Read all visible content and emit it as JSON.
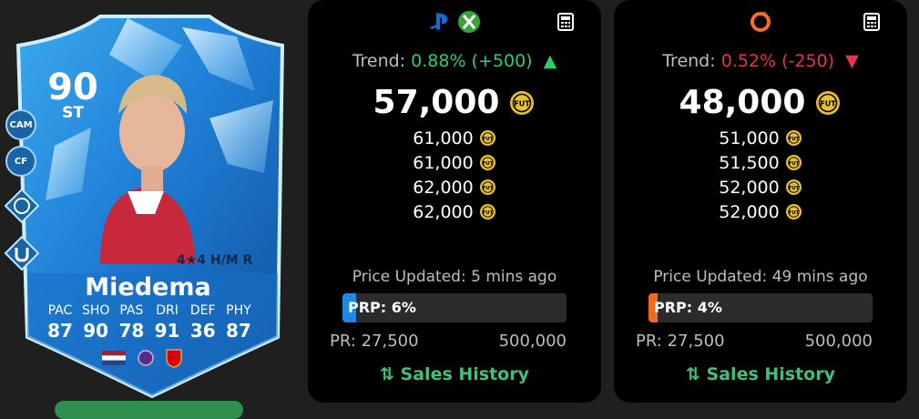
{
  "card": {
    "rating": "90",
    "position": "ST",
    "alt_positions": [
      "CAM",
      "CF"
    ],
    "skills": "4★4 H/M R",
    "name": "Miedema",
    "stats": [
      {
        "label": "PAC",
        "value": "87"
      },
      {
        "label": "SHO",
        "value": "90"
      },
      {
        "label": "PAS",
        "value": "78"
      },
      {
        "label": "DRI",
        "value": "91"
      },
      {
        "label": "DEF",
        "value": "36"
      },
      {
        "label": "PHY",
        "value": "87"
      }
    ],
    "icons": [
      "flag-netherlands-icon",
      "league-badge-icon",
      "club-badge-icon"
    ]
  },
  "panels": [
    {
      "platform_icons": [
        "playstation-icon",
        "xbox-icon"
      ],
      "trend_label": "Trend:",
      "trend_value": "0.88% (+500)",
      "trend_direction": "up",
      "price": "57,000",
      "listings": [
        "61,000",
        "61,000",
        "62,000",
        "62,000"
      ],
      "updated": "Price Updated: 5 mins ago",
      "prp_label": "PRP: 6%",
      "prp_fraction": 0.06,
      "prp_color": "#1e88e5",
      "pr_min": "PR: 27,500",
      "pr_max": "500,000",
      "sales_label": "Sales History"
    },
    {
      "platform_icons": [
        "origin-icon"
      ],
      "trend_label": "Trend:",
      "trend_value": "0.52% (-250)",
      "trend_direction": "down",
      "price": "48,000",
      "listings": [
        "51,000",
        "51,500",
        "52,000",
        "52,000"
      ],
      "updated": "Price Updated: 49 mins ago",
      "prp_label": "PRP: 4%",
      "prp_fraction": 0.04,
      "prp_color": "#f26a1b",
      "pr_min": "PR: 27,500",
      "pr_max": "500,000",
      "sales_label": "Sales History"
    }
  ],
  "colors": {
    "up": "#2ecc71",
    "down": "#e5334b",
    "sales": "#3ec27a",
    "coin": "#e8c02c"
  }
}
